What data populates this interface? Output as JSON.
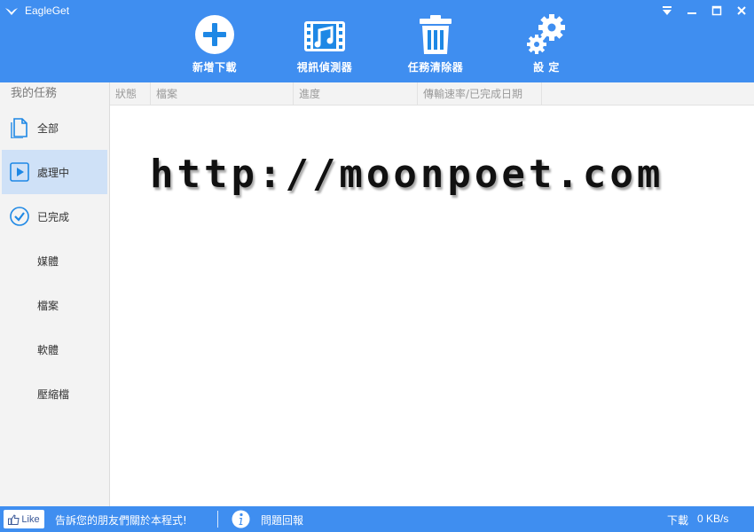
{
  "window": {
    "title": "EagleGet",
    "controls": [
      "dropdown-menu",
      "minimize",
      "maximize",
      "close"
    ]
  },
  "toolbar": {
    "add_download": "新增下載",
    "video_sniffer": "視訊偵測器",
    "task_cleaner": "任務清除器",
    "settings": "設 定"
  },
  "sidebar": {
    "header": "我的任務",
    "items": [
      {
        "label": "全部",
        "icon": "document-icon"
      },
      {
        "label": "處理中",
        "icon": "play-icon",
        "active": true
      },
      {
        "label": "已完成",
        "icon": "check-circle-icon"
      },
      {
        "label": "媒體"
      },
      {
        "label": "檔案"
      },
      {
        "label": "軟體"
      },
      {
        "label": "壓縮檔"
      }
    ]
  },
  "columns": {
    "status": "狀態",
    "file": "檔案",
    "progress": "進度",
    "speed_date": "傳輸速率/已完成日期"
  },
  "content": {
    "watermark": "http://moonpoet.com"
  },
  "statusbar": {
    "like": "Like",
    "share": "告訴您的朋友們關於本程式!",
    "feedback": "問題回報",
    "download_label": "下載",
    "download_speed": "0 KB/s"
  },
  "colors": {
    "brand_blue": "#3f8ef0",
    "active_item": "#cfe1f7",
    "icon_blue": "#1e88e5"
  }
}
